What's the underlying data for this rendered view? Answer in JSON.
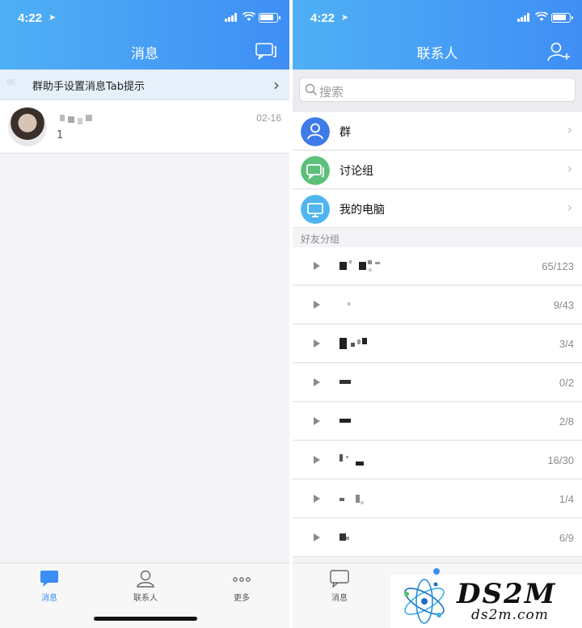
{
  "status_bar": {
    "time": "4:22"
  },
  "left_screen": {
    "header_title": "消息",
    "banner_text": "群助手设置消息Tab提示",
    "message": {
      "preview": "1",
      "date": "02-16"
    },
    "tabs": [
      {
        "label": "消息"
      },
      {
        "label": "联系人"
      },
      {
        "label": "更多"
      }
    ]
  },
  "right_screen": {
    "header_title": "联系人",
    "search_placeholder": "搜索",
    "categories": [
      {
        "label": "群",
        "icon": "group-icon",
        "color": "#3f7be8"
      },
      {
        "label": "讨论组",
        "icon": "discussion-icon",
        "color": "#5cc07a"
      },
      {
        "label": "我的电脑",
        "icon": "computer-icon",
        "color": "#4fb5f0"
      }
    ],
    "section_title": "好友分组",
    "groups": [
      {
        "count": "65/123"
      },
      {
        "count": "9/43"
      },
      {
        "count": "3/4"
      },
      {
        "count": "0/2"
      },
      {
        "count": "2/8"
      },
      {
        "count": "16/30"
      },
      {
        "count": "1/4"
      },
      {
        "count": "6/9"
      }
    ],
    "tabs": [
      {
        "label": "消息"
      }
    ]
  },
  "watermark": {
    "brand": "DS2M",
    "domain": "ds2m.com"
  },
  "colors": {
    "accent": "#3a8ef5",
    "header_start": "#4fb0f5",
    "header_end": "#3f8ef5"
  }
}
